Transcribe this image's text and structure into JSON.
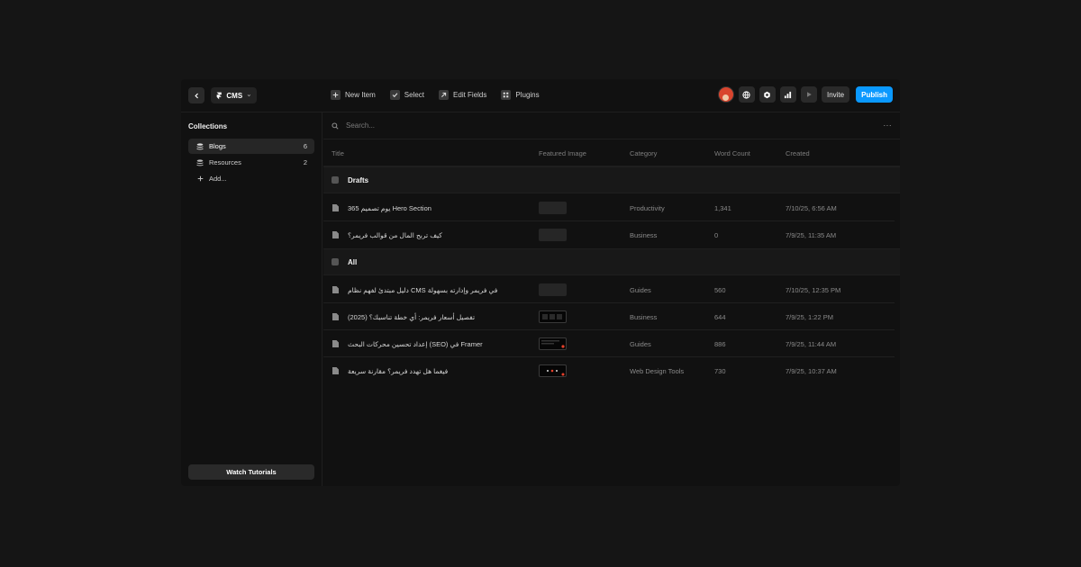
{
  "topbar": {
    "project": "CMS",
    "toolbar": [
      {
        "label": "New Item",
        "icon": "plus-square-icon"
      },
      {
        "label": "Select",
        "icon": "checkbox-icon"
      },
      {
        "label": "Edit Fields",
        "icon": "arrow-up-right-icon"
      },
      {
        "label": "Plugins",
        "icon": "grid-icon"
      }
    ],
    "invite_label": "Invite",
    "publish_label": "Publish",
    "publish_color": "#0a99ff"
  },
  "sidebar": {
    "title": "Collections",
    "items": [
      {
        "label": "Blogs",
        "count": "6",
        "active": true
      },
      {
        "label": "Resources",
        "count": "2",
        "active": false
      }
    ],
    "add_label": "Add...",
    "tutorials_label": "Watch Tutorials"
  },
  "main": {
    "search_placeholder": "Search...",
    "columns": {
      "title": "Title",
      "image": "Featured Image",
      "category": "Category",
      "word_count": "Word Count",
      "created": "Created"
    },
    "groups": [
      {
        "label": "Drafts",
        "rows": [
          {
            "title": "365 يوم تصميم Hero Section",
            "category": "Productivity",
            "word_count": "1,341",
            "created": "7/10/25, 6:56 AM",
            "thumb": "empty"
          },
          {
            "title": "كيف تربح المال من قوالب فريمر؟",
            "category": "Business",
            "word_count": "0",
            "created": "7/9/25, 11:35 AM",
            "thumb": "empty"
          }
        ]
      },
      {
        "label": "All",
        "rows": [
          {
            "title": "دليل مبتدئ لفهم نظام CMS في فريمر وإدارته بسهولة",
            "category": "Guides",
            "word_count": "560",
            "created": "7/10/25, 12:35 PM",
            "thumb": "empty"
          },
          {
            "title": "تفصيل أسعار فريمر: أي خطة تناسبك؟ (2025)",
            "category": "Business",
            "word_count": "644",
            "created": "7/9/25, 1:22 PM",
            "thumb": "image"
          },
          {
            "title": "إعداد تحسين محركات البحث (SEO) في Framer",
            "category": "Guides",
            "word_count": "886",
            "created": "7/9/25, 11:44 AM",
            "thumb": "image"
          },
          {
            "title": "فيغما هل تهدد فريمر؟ مقارنة سريعة",
            "category": "Web Design Tools",
            "word_count": "730",
            "created": "7/9/25, 10:37 AM",
            "thumb": "image"
          }
        ]
      }
    ]
  }
}
